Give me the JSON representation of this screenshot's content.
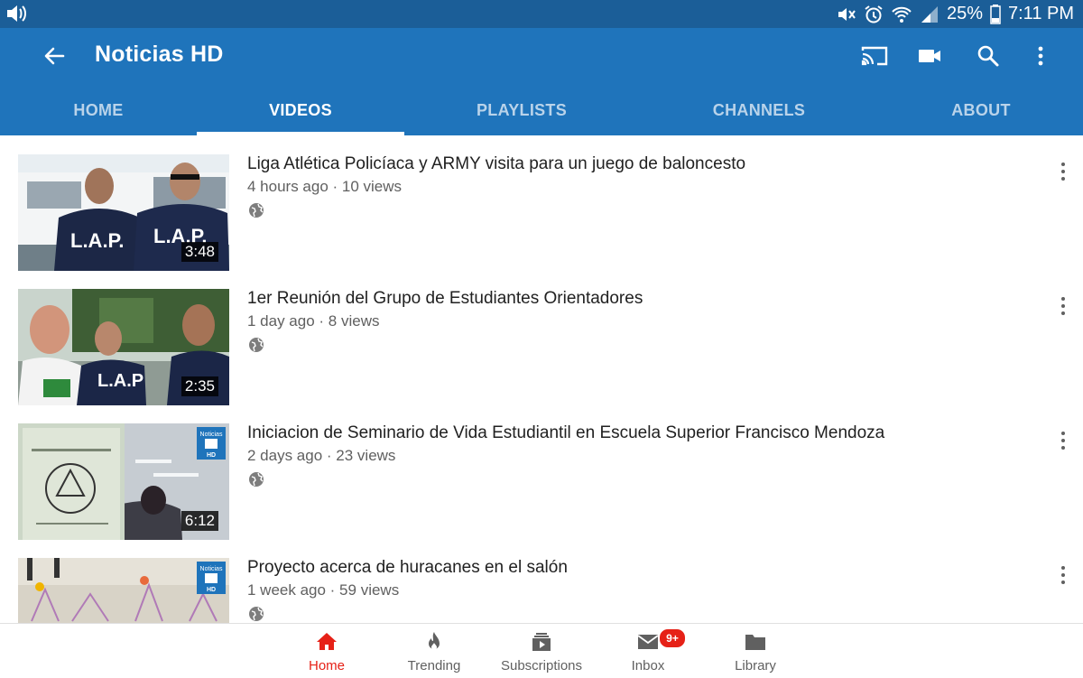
{
  "status_bar": {
    "battery": "25%",
    "time": "7:11 PM"
  },
  "app_bar": {
    "title": "Noticias HD",
    "actions": [
      "cast-icon",
      "video-camera-icon",
      "search-icon",
      "more-vert-icon"
    ]
  },
  "tabs": [
    {
      "label": "HOME",
      "active": false
    },
    {
      "label": "VIDEOS",
      "active": true
    },
    {
      "label": "PLAYLISTS",
      "active": false
    },
    {
      "label": "CHANNELS",
      "active": false
    },
    {
      "label": "ABOUT",
      "active": false
    }
  ],
  "videos": [
    {
      "title": "Liga Atlética Policíaca y ARMY visita para un juego de baloncesto",
      "meta": "4 hours ago · 10 views",
      "duration": "3:48",
      "thumb_text": [
        "L.A.P.",
        "L.A.P."
      ]
    },
    {
      "title": "1er Reunión del Grupo de Estudiantes Orientadores",
      "meta": "1 day ago · 8 views",
      "duration": "2:35",
      "thumb_text": [
        "L.A.P"
      ]
    },
    {
      "title": "Iniciacion de Seminario de Vida Estudiantil en Escuela Superior Francisco Mendoza",
      "meta": "2 days ago · 23 views",
      "duration": "6:12",
      "thumb_text": [
        "Noticias",
        "HD"
      ]
    },
    {
      "title": "Proyecto acerca de huracanes en el salón",
      "meta": "1 week ago · 59 views",
      "duration": "",
      "thumb_text": [
        "Noticias",
        "HD"
      ]
    }
  ],
  "bottom_nav": [
    {
      "label": "Home",
      "icon": "home-icon",
      "active": true
    },
    {
      "label": "Trending",
      "icon": "flame-icon",
      "active": false
    },
    {
      "label": "Subscriptions",
      "icon": "subscriptions-icon",
      "active": false
    },
    {
      "label": "Inbox",
      "icon": "inbox-icon",
      "active": false,
      "badge": "9+"
    },
    {
      "label": "Library",
      "icon": "folder-icon",
      "active": false
    }
  ],
  "colors": {
    "status_bar": "#1b5e98",
    "app_bar": "#1f74bb",
    "active_nav": "#e62117"
  }
}
